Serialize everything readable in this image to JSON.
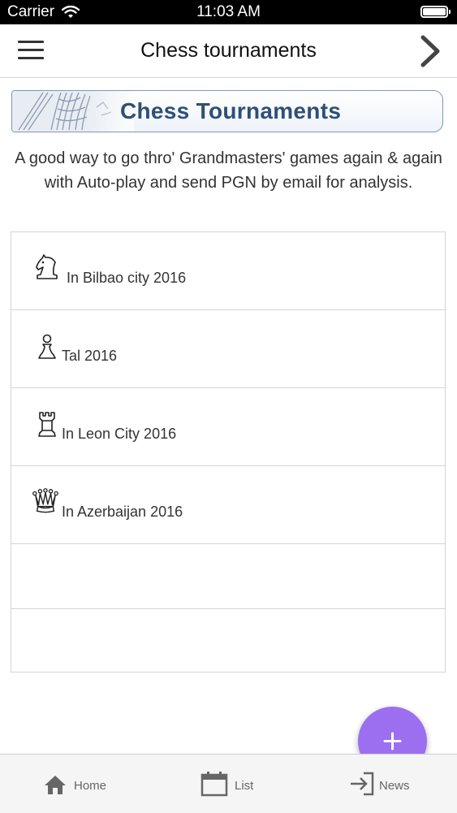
{
  "status_bar": {
    "carrier": "Carrier",
    "time": "11:03 AM"
  },
  "nav": {
    "title": "Chess tournaments",
    "menu_icon": "hamburger-menu-icon",
    "forward_icon": "chevron-right-icon"
  },
  "banner": {
    "title": "Chess Tournaments"
  },
  "description": "A good way to go thro' Grandmasters' games again & again with Auto-play and send PGN by email for analysis.",
  "tournaments": [
    {
      "label": "In Bilbao city 2016",
      "icon": "knight-icon"
    },
    {
      "label": "Tal 2016",
      "icon": "pawn-icon"
    },
    {
      "label": "In Leon City 2016",
      "icon": "rook-icon"
    },
    {
      "label": "In Azerbaijan 2016",
      "icon": "queen-icon"
    }
  ],
  "fab": {
    "label": "+",
    "color": "#9b6ff0"
  },
  "tabs": [
    {
      "label": "Home",
      "icon": "home-icon"
    },
    {
      "label": "List",
      "icon": "calendar-icon"
    },
    {
      "label": "News",
      "icon": "sign-in-icon"
    }
  ],
  "colors": {
    "accent": "#9b6ff0",
    "banner_text": "#2e5078"
  }
}
